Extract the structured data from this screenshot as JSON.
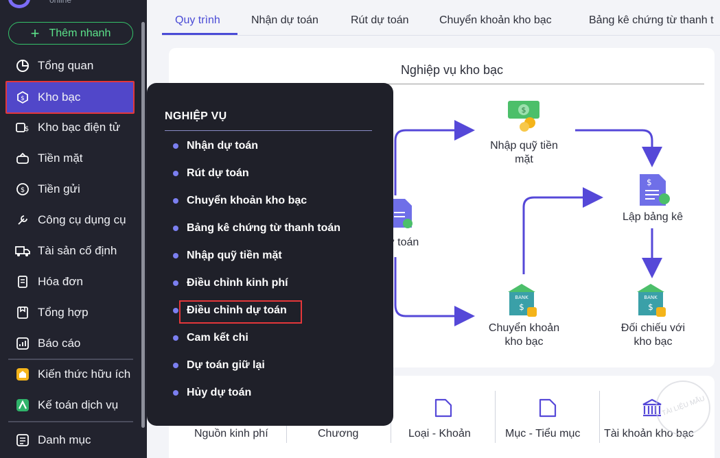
{
  "sidebar": {
    "logo_sub": "online",
    "quick_add": "Thêm nhanh",
    "items": [
      {
        "label": "Tổng quan",
        "icon": "pie-chart-icon"
      },
      {
        "label": "Kho bạc",
        "icon": "treasury-icon"
      },
      {
        "label": "Kho bạc điện tử",
        "icon": "e-treasury-icon"
      },
      {
        "label": "Tiền mặt",
        "icon": "cash-icon"
      },
      {
        "label": "Tiền gửi",
        "icon": "deposit-icon"
      },
      {
        "label": "Công cụ dụng cụ",
        "icon": "tools-icon"
      },
      {
        "label": "Tài sản cố định",
        "icon": "truck-icon"
      },
      {
        "label": "Hóa đơn",
        "icon": "invoice-icon"
      },
      {
        "label": "Tổng hợp",
        "icon": "summary-icon"
      },
      {
        "label": "Báo cáo",
        "icon": "report-icon"
      },
      {
        "label": "Kiến thức hữu ích",
        "icon": "knowledge-icon"
      },
      {
        "label": "Kế toán dịch vụ",
        "icon": "service-icon"
      },
      {
        "label": "Danh mục",
        "icon": "catalog-icon"
      }
    ]
  },
  "tabs": [
    "Quy trình",
    "Nhận dự toán",
    "Rút dự toán",
    "Chuyển khoản kho bạc",
    "Bảng kê chứng từ thanh t"
  ],
  "card": {
    "title": "Nghiệp vụ kho bạc",
    "nodes": {
      "nhap_quy": [
        "Nhập quỹ tiền",
        "mặt"
      ],
      "lap_bang_ke": [
        "Lập bảng kê"
      ],
      "du_toan": [
        "ự toán"
      ],
      "chuyen_khoan": [
        "Chuyển khoản",
        "kho bạc"
      ],
      "doi_chieu": [
        "Đối chiếu với",
        "kho bạc"
      ]
    }
  },
  "categories": [
    "Nguồn kinh phí",
    "Chương",
    "Loại - Khoản",
    "Mục - Tiểu mục",
    "Tài khoản kho bạc"
  ],
  "popover": {
    "title": "NGHIỆP VỤ",
    "items": [
      "Nhận dự toán",
      "Rút dự toán",
      "Chuyển khoản kho bạc",
      "Bảng kê chứng từ thanh toán",
      "Nhập quỹ tiền mặt",
      "Điều chỉnh kinh phí",
      "Điều chỉnh dự toán",
      "Cam kết chi",
      "Dự toán giữ lại",
      "Hủy dự toán"
    ]
  },
  "watermark": "TÀI LIỆU MẪU",
  "colors": {
    "accent": "#4a4bd6",
    "sidebar_bg": "#22232e",
    "highlight_border": "#e5373a",
    "quick_add_green": "#35c46a"
  }
}
